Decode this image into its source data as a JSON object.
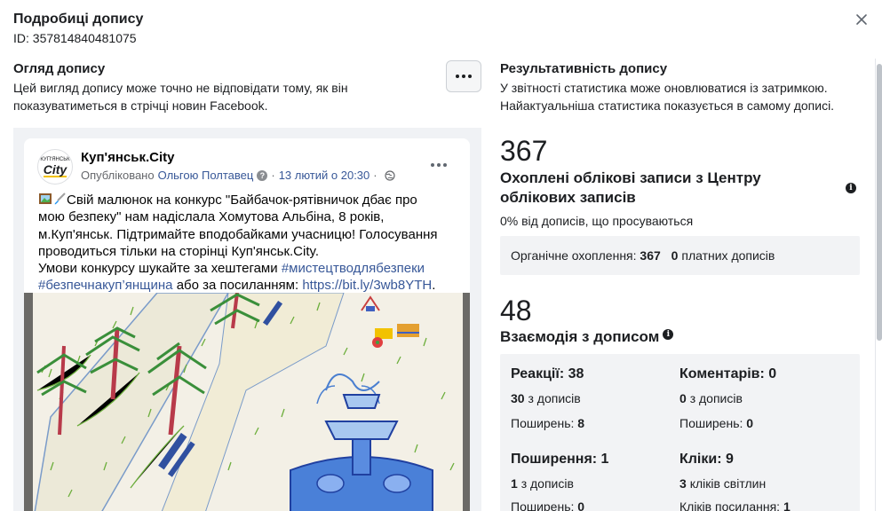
{
  "header": {
    "title": "Подробиці допису",
    "id_text": "ID: 357814840481075"
  },
  "preview": {
    "title": "Огляд допису",
    "description_line1": "Цей вигляд допису може точно не відповідати тому, як він",
    "description_line2": "показуватиметься в стрічці новин Facebook."
  },
  "post": {
    "avatar_small": "КУП'ЯНСЬК",
    "avatar_big": "City",
    "page_name": "Куп'янськ.City",
    "published_prefix": "Опубліковано",
    "publisher": "Ольгою Полтавец",
    "date": "13 лютий о 20:30",
    "text_line1": "Свій малюнок на конкурс \"Байбачок-рятівничок дбає про",
    "text_line2": "мою безпеку\" нам надіслала Хомутова Альбіна, 8 років,",
    "text_line3": "м.Куп'янськ. Підтримайте вподобайками учасницю! Голосування",
    "text_line4": "проводиться тільки на сторінці Куп'янськ.City.",
    "text_line5": "Умови конкурсу шукайте за хештегами",
    "hashtag1": "#мистецтводлябезпеки",
    "hashtag2": "#безпечнакуп’янщина",
    "text_line6_mid": "або за посиланням:",
    "link": "https://bit.ly/3wb8YTH",
    "text_end": "."
  },
  "performance": {
    "title": "Результативність допису",
    "description_line1": "У звітності статистика може оновлюватися із затримкою.",
    "description_line2": "Найактуальніша статистика показується в самому дописі.",
    "reach": {
      "value": "367",
      "label_line1": "Охоплені облікові записи з Центру",
      "label_line2": "облікових записів",
      "sub": "0% від дописів, що просуваються",
      "organic_label": "Органічне охоплення:",
      "organic_value": "367",
      "paid_value": "0",
      "paid_label": "платних дописів"
    },
    "engagement": {
      "value": "48",
      "label": "Взаємодія з дописом",
      "reactions_title": "Реакції: 38",
      "reactions_from_num": "30",
      "reactions_from_label": "з дописів",
      "reactions_shares_label": "Поширень:",
      "reactions_shares_value": "8",
      "comments_title": "Коментарів: 0",
      "comments_from_num": "0",
      "comments_from_label": "з дописів",
      "comments_shares_label": "Поширень:",
      "comments_shares_value": "0",
      "shares_title": "Поширення: 1",
      "shares_from_num": "1",
      "shares_from_label": "з дописів",
      "shares_shares_label": "Поширень:",
      "shares_shares_value": "0",
      "clicks_title": "Кліки: 9",
      "clicks_photo_num": "3",
      "clicks_photo_label": "кліків світлин",
      "clicks_link_label": "Кліків посилання:",
      "clicks_link_value": "1"
    }
  },
  "icons": {
    "close": "close-icon",
    "more": "more-horizontal-icon",
    "info": "info-icon",
    "question": "question-icon",
    "globe": "globe-icon"
  }
}
